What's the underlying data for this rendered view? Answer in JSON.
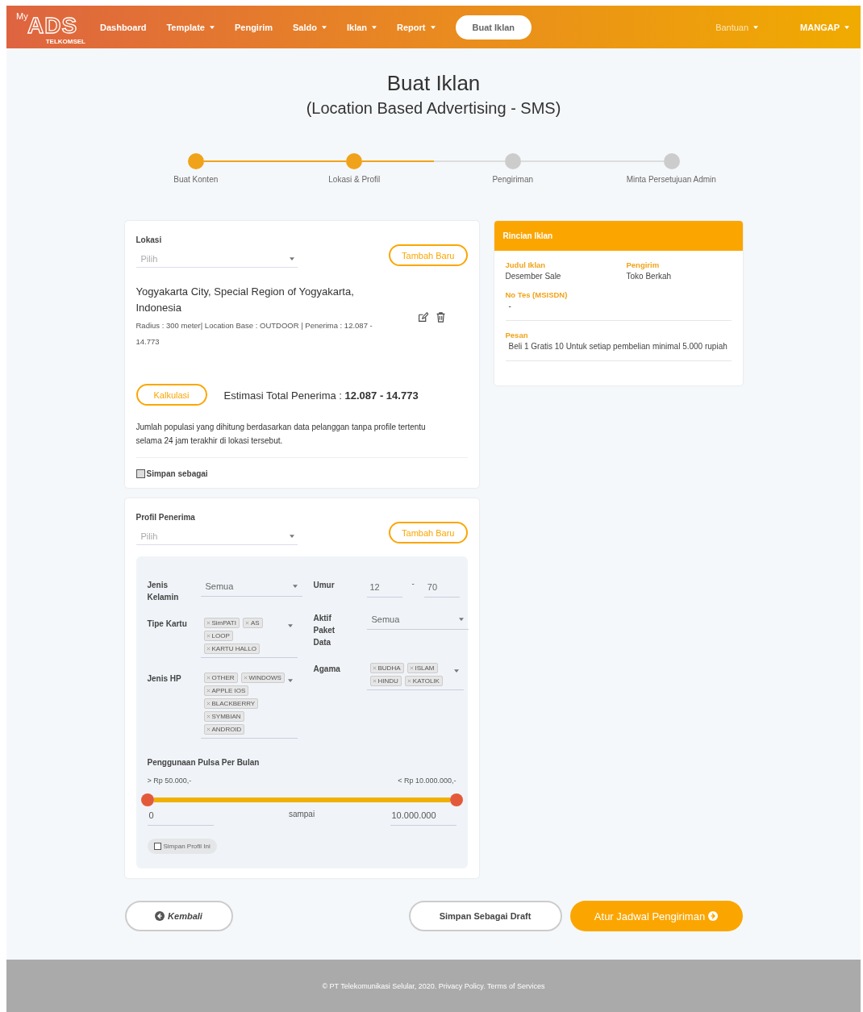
{
  "navbar": {
    "logo": {
      "top": "My",
      "main": "ADS",
      "sub": "TELKOMSEL"
    },
    "items": [
      {
        "label": "Dashboard",
        "dropdown": false
      },
      {
        "label": "Template",
        "dropdown": true
      },
      {
        "label": "Pengirim",
        "dropdown": false
      },
      {
        "label": "Saldo",
        "dropdown": true
      },
      {
        "label": "Iklan",
        "dropdown": true
      },
      {
        "label": "Report",
        "dropdown": true
      }
    ],
    "action_button": "Buat Iklan",
    "help": "Bantuan",
    "user": "MANGAP"
  },
  "title": "Buat Iklan",
  "subtitle": "(Location Based Advertising - SMS)",
  "stepper": {
    "steps": [
      {
        "label": "Buat Konten",
        "completed": true
      },
      {
        "label": "Lokasi & Profil",
        "completed": true
      },
      {
        "label": "Pengiriman",
        "completed": false
      },
      {
        "label": "Minta Persetujuan Admin",
        "completed": false
      }
    ]
  },
  "location_card": {
    "label": "Lokasi",
    "select": {
      "placeholder": "Pilih"
    },
    "add_button": "Tambah Baru",
    "location": {
      "name": "Yogyakarta City, Special Region of Yogyakarta, Indonesia",
      "details": "Radius : 300 meter| Location Base : OUTDOOR | Penerima : 12.087 - 14.773"
    },
    "calc_button": "Kalkulasi",
    "estimate": "Estimasi Total Penerima : **12.087 - 14.773**",
    "note": "Jumlah populasi yang dihitung berdasarkan data pelanggan tanpa profile tertentu selama 24 jam terakhir di lokasi tersebut.",
    "save": {
      "label": "Simpan sebagai",
      "checked": false
    }
  },
  "profile_card": {
    "label": "Profil Penerima",
    "select": {
      "placeholder": "Pilih"
    },
    "add_button": "Tambah Baru",
    "filters_left": [
      {
        "label": "Jenis Kelamin",
        "kind": "select",
        "value": "Semua"
      },
      {
        "label": "Tipe Kartu",
        "kind": "tags",
        "tags": [
          "SimPATI",
          "AS",
          "LOOP",
          "KARTU HALLO"
        ]
      },
      {
        "label": "Jenis HP",
        "kind": "tags",
        "tags": [
          "OTHER",
          "WINDOWS",
          "APPLE IOS",
          "BLACKBERRY",
          "SYMBIAN",
          "ANDROID"
        ]
      }
    ],
    "filters_right": [
      {
        "label": "Umur",
        "kind": "range",
        "from": "12",
        "separator": "-",
        "to": "70"
      },
      {
        "label": "Aktif Paket Data",
        "kind": "select",
        "value": "Semua"
      },
      {
        "label": "Agama",
        "kind": "tags",
        "tags": [
          "BUDHA",
          "ISLAM",
          "HINDU",
          "KATOLIK"
        ]
      }
    ],
    "usage": {
      "label": "Penggunaan Pulsa Per Bulan",
      "min_label": "> Rp 50.000,-",
      "max_label": "< Rp 10.000.000,-",
      "from": "0",
      "between": "sampai",
      "to": "10.000.000"
    },
    "save": {
      "label": "Simpan Profil Ini",
      "checked": false
    }
  },
  "summary": {
    "title": "Rincian Iklan",
    "top_fields": [
      {
        "label": "Judul Iklan",
        "value": "Desember Sale"
      },
      {
        "label": "Pengirim",
        "value": "Toko Berkah"
      }
    ],
    "fields": [
      {
        "label": "No Tes (MSISDN)",
        "value": "-"
      },
      {
        "label": "Pesan",
        "value": "Beli 1 Gratis 10 Untuk setiap pembelian minimal 5.000 rupiah"
      }
    ]
  },
  "actions": {
    "back": "Kembali",
    "draft": "Simpan Sebagai Draft",
    "next": "Atur Jadwal Pengiriman"
  },
  "footer": "© PT Telekomunikasi Selular, 2020. Privacy Policy. Terms of Services"
}
